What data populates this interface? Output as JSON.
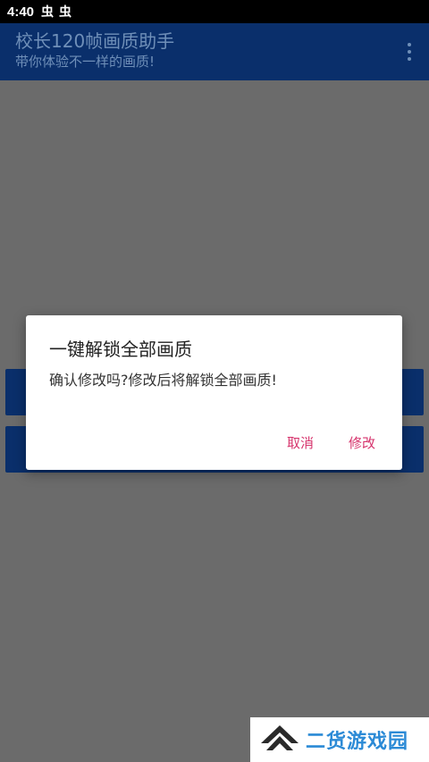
{
  "status_bar": {
    "time": "4:40",
    "notification_icons": [
      "虫",
      "虫"
    ]
  },
  "app_bar": {
    "title": "校长120帧画质助手",
    "subtitle": "带你体验不一样的画质!"
  },
  "dialog": {
    "title": "一键解锁全部画质",
    "message": "确认修改吗?修改后将解锁全部画质!",
    "cancel_label": "取消",
    "confirm_label": "修改"
  },
  "watermark": {
    "text": "二货游戏园"
  },
  "colors": {
    "app_bar": "#0a2f6b",
    "scrim": "#6b6b6b",
    "dialog_button": "#d6336c",
    "watermark_text": "#2b8ad6"
  }
}
